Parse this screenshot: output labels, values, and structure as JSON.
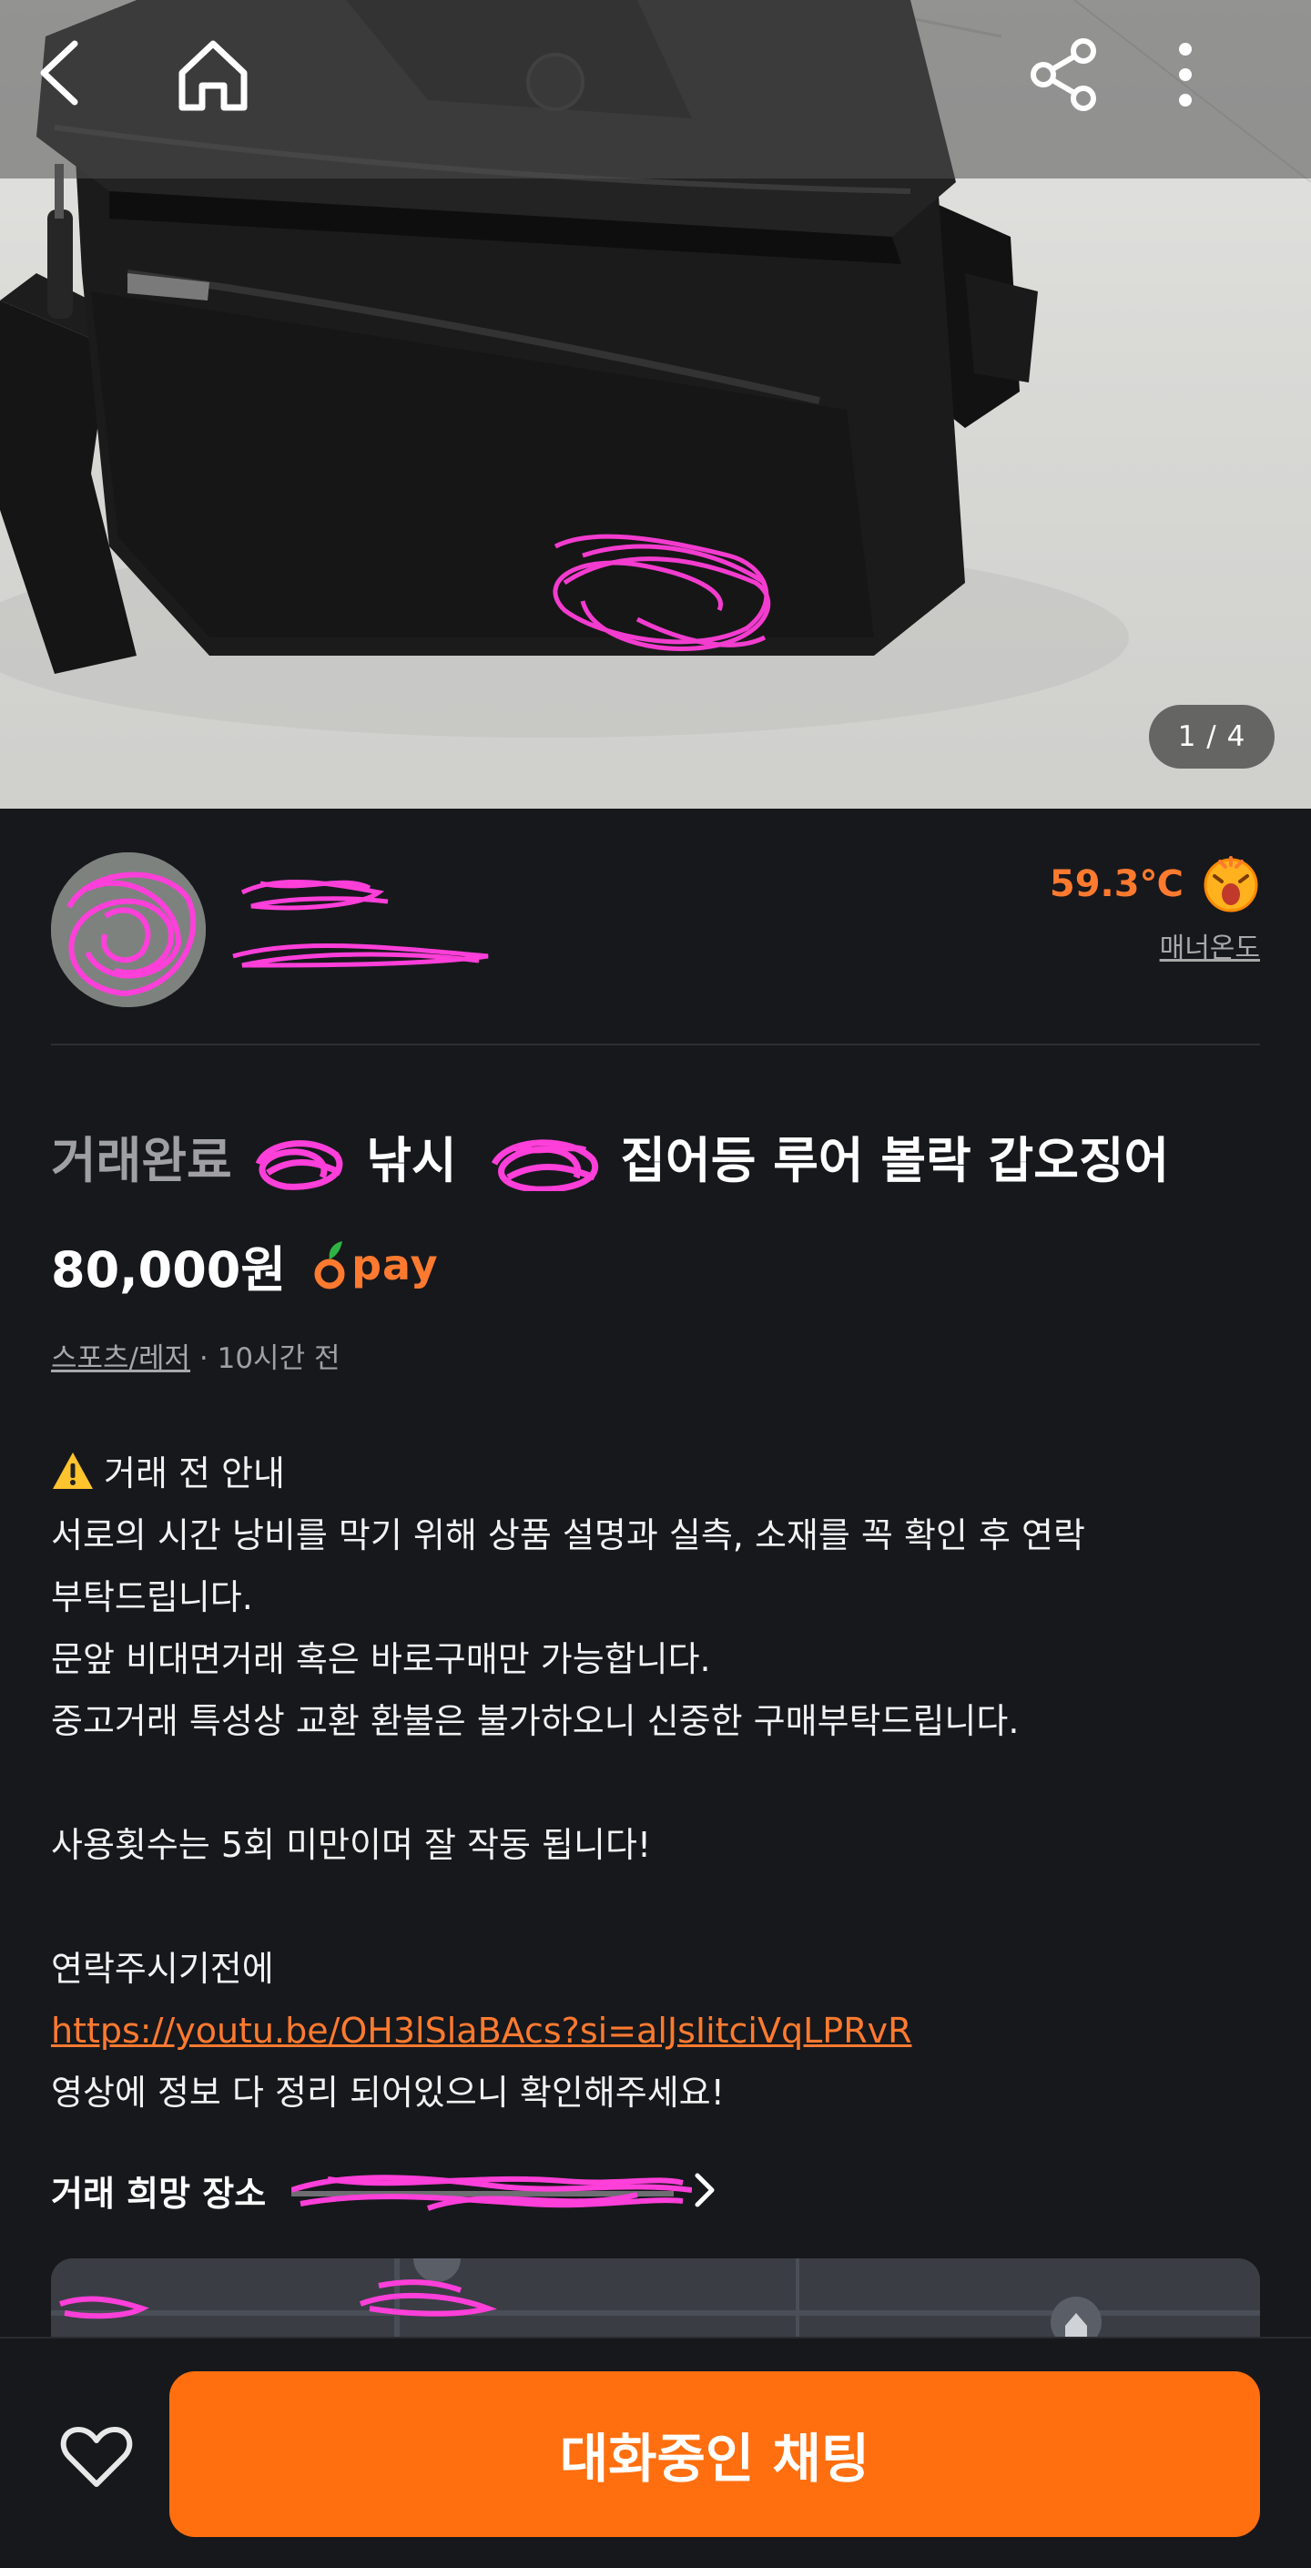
{
  "gallery": {
    "page_indicator": "1 / 4",
    "current_page": 1,
    "total_pages": 4
  },
  "top_bar": {
    "icons": [
      "back-icon",
      "home-icon",
      "share-icon",
      "more-icon"
    ]
  },
  "seller": {
    "manner_temperature": "59.3℃",
    "manner_label": "매너온도"
  },
  "product": {
    "status": "거래완료",
    "title_parts": [
      "낚시",
      "집어등 루어 볼락 갑오징어"
    ],
    "price": "80,000원",
    "pay_label": "pay",
    "category": "스포츠/레저",
    "time_ago": " · 10시간 전"
  },
  "description": {
    "notice_title": "거래 전 안내",
    "lines": [
      "서로의 시간 낭비를 막기 위해 상품 설명과 실측, 소재를 꼭 확인 후 연락",
      "부탁드립니다.",
      "문앞 비대면거래 혹은 바로구매만 가능합니다.",
      "중고거래 특성상 교환 환불은 불가하오니 신중한 구매부탁드립니다."
    ],
    "usage_line": "사용횟수는 5회 미만이며 잘 작동 됩니다!",
    "contact_line": "연락주시기전에",
    "link": "https://youtu.be/OH3lSlaBAcs?si=alJsIitciVqLPRvR",
    "closing_line": "영상에 정보 다 정리 되어있으니 확인해주세요!"
  },
  "place": {
    "label": "거래 희망 장소"
  },
  "bottom": {
    "chat_button_label": "대화중인 채팅"
  },
  "colors": {
    "accent": "#ff6f0f",
    "background": "#17181c",
    "temperature": "#ff7a2f"
  }
}
